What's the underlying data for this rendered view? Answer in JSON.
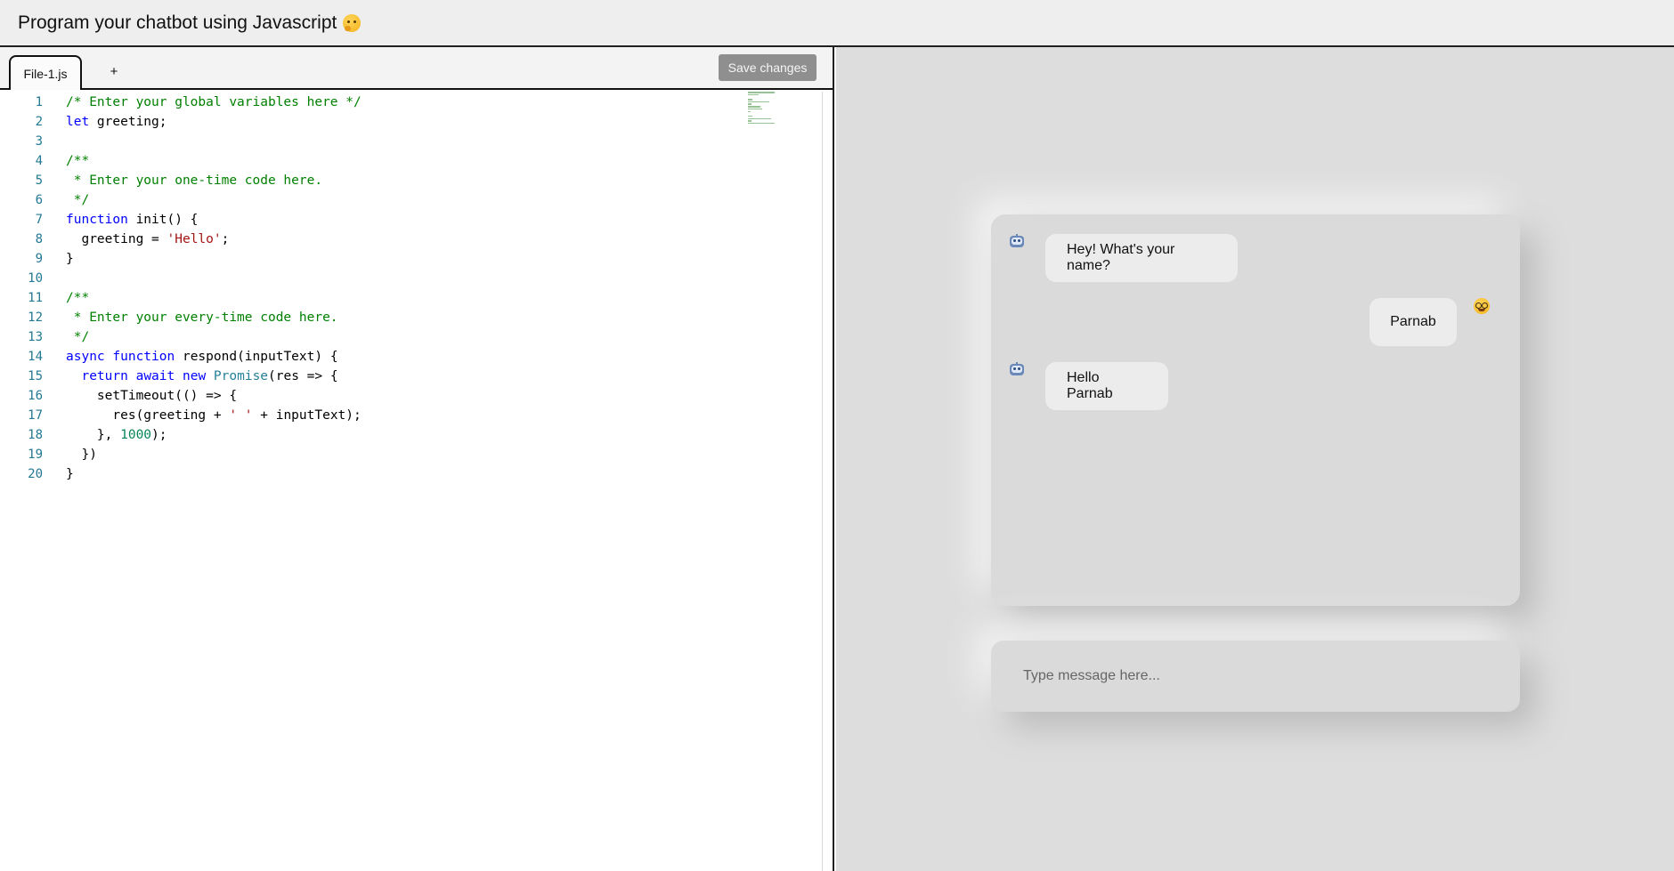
{
  "header": {
    "title": "Program your chatbot using Javascript",
    "title_emoji": "thinking-face-icon"
  },
  "editor": {
    "tabs": [
      {
        "label": "File-1.js",
        "active": true
      }
    ],
    "add_tab_label": "+",
    "save_label": "Save changes",
    "lines": [
      {
        "n": "1"
      },
      {
        "n": "2"
      },
      {
        "n": "3"
      },
      {
        "n": "4"
      },
      {
        "n": "5"
      },
      {
        "n": "6"
      },
      {
        "n": "7"
      },
      {
        "n": "8"
      },
      {
        "n": "9"
      },
      {
        "n": "10"
      },
      {
        "n": "11"
      },
      {
        "n": "12"
      },
      {
        "n": "13"
      },
      {
        "n": "14"
      },
      {
        "n": "15"
      },
      {
        "n": "16"
      },
      {
        "n": "17"
      },
      {
        "n": "18"
      },
      {
        "n": "19"
      },
      {
        "n": "20"
      }
    ],
    "code": [
      "/* Enter your global variables here */",
      "let greeting;",
      "",
      "/**",
      " * Enter your one-time code here.",
      " */",
      "function init() {",
      "  greeting = 'Hello';",
      "}",
      "",
      "/**",
      " * Enter your every-time code here.",
      " */",
      "async function respond(inputText) {",
      "  return await new Promise(res => {",
      "    setTimeout(() => {",
      "      res(greeting + ' ' + inputText);",
      "    }, 1000);",
      "  })",
      "}"
    ]
  },
  "chat": {
    "messages": [
      {
        "sender": "bot",
        "text": "Hey! What's your name?",
        "avatar": "robot-icon"
      },
      {
        "sender": "user",
        "text": "Parnab",
        "avatar": "nerd-face-icon"
      },
      {
        "sender": "bot",
        "text": "Hello Parnab",
        "avatar": "robot-icon"
      }
    ],
    "input_placeholder": "Type message here...",
    "input_value": ""
  },
  "colors": {
    "line_number": "#237893",
    "comment": "#008000",
    "keyword": "#0000ff",
    "string": "#a31515",
    "number": "#098658",
    "type": "#267f99",
    "save_button": "#8f8f8f",
    "chat_background": "#dddddd"
  }
}
